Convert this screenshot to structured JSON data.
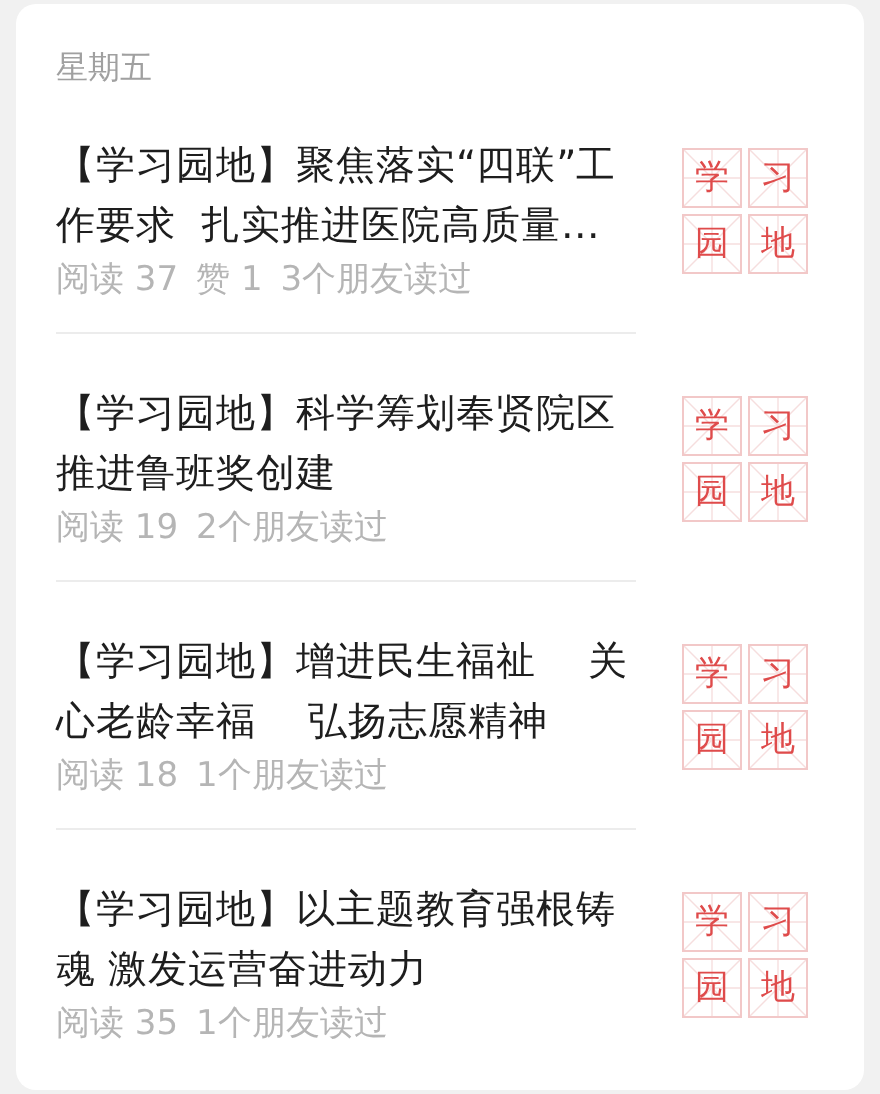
{
  "day_label": "星期五",
  "articles": [
    {
      "title": "【学习园地】聚焦落实“四联”工作要求  扎实推进医院高质量…",
      "meta": [
        "阅读 37",
        "赞 1",
        "3个朋友读过"
      ],
      "thumbnail": [
        "学",
        "习",
        "园",
        "地"
      ]
    },
    {
      "title": "【学习园地】科学筹划奉贤院区推进鲁班奖创建",
      "meta": [
        "阅读 19",
        "2个朋友读过"
      ],
      "thumbnail": [
        "学",
        "习",
        "园",
        "地"
      ]
    },
    {
      "title": "【学习园地】增进民生福祉　 关心老龄幸福　 弘扬志愿精神",
      "meta": [
        "阅读 18",
        "1个朋友读过"
      ],
      "thumbnail": [
        "学",
        "习",
        "园",
        "地"
      ]
    },
    {
      "title": "【学习园地】以主题教育强根铸魂 激发运营奋进动力",
      "meta": [
        "阅读 35",
        "1个朋友读过"
      ],
      "thumbnail": [
        "学",
        "习",
        "园",
        "地"
      ]
    }
  ]
}
